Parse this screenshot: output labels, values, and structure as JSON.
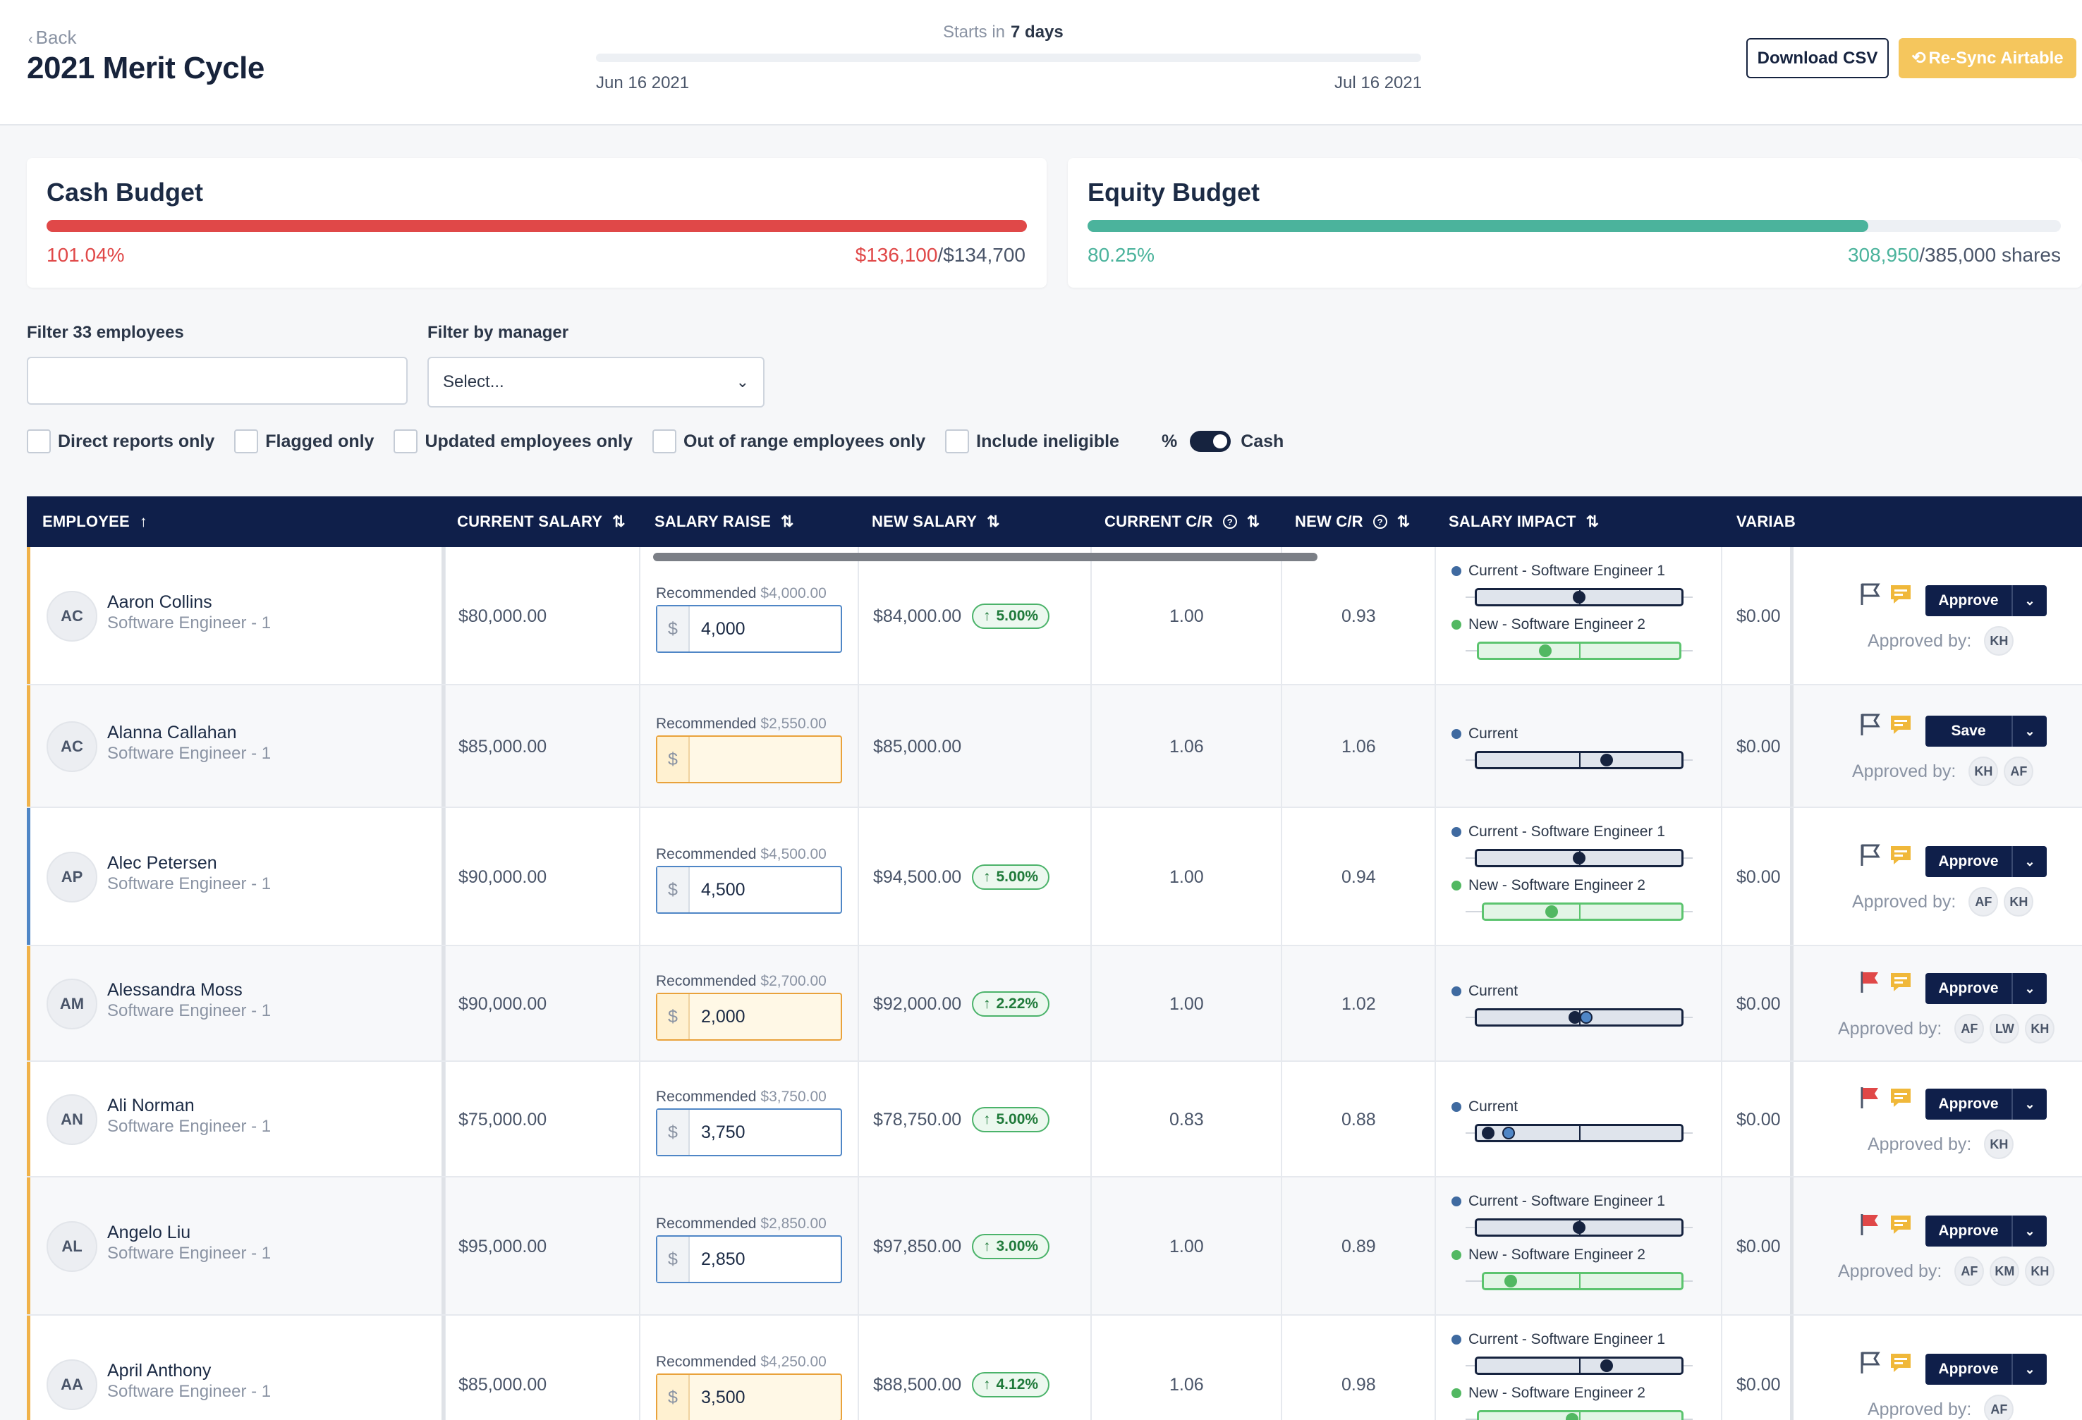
{
  "header": {
    "back_label": "Back",
    "title": "2021 Merit Cycle",
    "starts_prefix": "Starts in",
    "starts_value": "7 days",
    "date_start": "Jun 16 2021",
    "date_end": "Jul 16 2021",
    "download_label": "Download CSV",
    "resync_label": "Re-Sync Airtable"
  },
  "budgets": {
    "cash": {
      "title": "Cash Budget",
      "percent": "101.04%",
      "used": "$136,100",
      "total": "/$134,700",
      "fill_percent": 100,
      "color": "#e04848"
    },
    "equity": {
      "title": "Equity Budget",
      "percent": "80.25%",
      "used": "308,950",
      "total": "/385,000 shares",
      "fill_percent": 80.25,
      "color": "#4bb39c"
    }
  },
  "filters": {
    "employees_label": "Filter 33 employees",
    "employees_value": "",
    "manager_label": "Filter by manager",
    "manager_value": "Select...",
    "checkboxes": [
      "Direct reports only",
      "Flagged only",
      "Updated employees only",
      "Out of range employees only",
      "Include ineligible"
    ],
    "toggle_left": "%",
    "toggle_right": "Cash"
  },
  "table": {
    "columns": [
      "EMPLOYEE",
      "CURRENT SALARY",
      "SALARY RAISE",
      "NEW SALARY",
      "CURRENT C/R",
      "NEW C/R",
      "SALARY IMPACT",
      "VARIAB"
    ],
    "recommended_prefix": "Recommended",
    "approved_by_label": "Approved by:",
    "rows": [
      {
        "initials": "AC",
        "name": "Aaron Collins",
        "title": "Software Engineer - 1",
        "current_salary": "$80,000.00",
        "recommended": "$4,000.00",
        "raise": "4,000",
        "new_salary": "$84,000.00",
        "raise_pct": "5.00%",
        "current_cr": "1.00",
        "new_cr": "0.93",
        "impact_current": "Current - Software Engineer 1",
        "impact_new": "New - Software Engineer 2",
        "variable": "$0.00",
        "action": "Approve",
        "approvers": [
          "KH"
        ]
      },
      {
        "initials": "AC",
        "name": "Alanna Callahan",
        "title": "Software Engineer - 1",
        "current_salary": "$85,000.00",
        "recommended": "$2,550.00",
        "raise": "",
        "new_salary": "$85,000.00",
        "raise_pct": "",
        "current_cr": "1.06",
        "new_cr": "1.06",
        "impact_current": "Current",
        "impact_new": "",
        "variable": "$0.00",
        "action": "Save",
        "approvers": [
          "KH",
          "AF"
        ]
      },
      {
        "initials": "AP",
        "name": "Alec Petersen",
        "title": "Software Engineer - 1",
        "current_salary": "$90,000.00",
        "recommended": "$4,500.00",
        "raise": "4,500",
        "new_salary": "$94,500.00",
        "raise_pct": "5.00%",
        "current_cr": "1.00",
        "new_cr": "0.94",
        "impact_current": "Current - Software Engineer 1",
        "impact_new": "New - Software Engineer 2",
        "variable": "$0.00",
        "action": "Approve",
        "approvers": [
          "AF",
          "KH"
        ]
      },
      {
        "initials": "AM",
        "name": "Alessandra Moss",
        "title": "Software Engineer - 1",
        "current_salary": "$90,000.00",
        "recommended": "$2,700.00",
        "raise": "2,000",
        "new_salary": "$92,000.00",
        "raise_pct": "2.22%",
        "current_cr": "1.00",
        "new_cr": "1.02",
        "impact_current": "Current",
        "impact_new": "",
        "variable": "$0.00",
        "action": "Approve",
        "approvers": [
          "AF",
          "LW",
          "KH"
        ]
      },
      {
        "initials": "AN",
        "name": "Ali Norman",
        "title": "Software Engineer - 1",
        "current_salary": "$75,000.00",
        "recommended": "$3,750.00",
        "raise": "3,750",
        "new_salary": "$78,750.00",
        "raise_pct": "5.00%",
        "current_cr": "0.83",
        "new_cr": "0.88",
        "impact_current": "Current",
        "impact_new": "",
        "variable": "$0.00",
        "action": "Approve",
        "approvers": [
          "KH"
        ]
      },
      {
        "initials": "AL",
        "name": "Angelo Liu",
        "title": "Software Engineer - 1",
        "current_salary": "$95,000.00",
        "recommended": "$2,850.00",
        "raise": "2,850",
        "new_salary": "$97,850.00",
        "raise_pct": "3.00%",
        "current_cr": "1.00",
        "new_cr": "0.89",
        "impact_current": "Current - Software Engineer 1",
        "impact_new": "New - Software Engineer 2",
        "variable": "$0.00",
        "action": "Approve",
        "approvers": [
          "AF",
          "KM",
          "KH"
        ]
      },
      {
        "initials": "AA",
        "name": "April Anthony",
        "title": "Software Engineer - 1",
        "current_salary": "$85,000.00",
        "recommended": "$4,250.00",
        "raise": "3,500",
        "new_salary": "$88,500.00",
        "raise_pct": "4.12%",
        "current_cr": "1.06",
        "new_cr": "0.98",
        "impact_current": "Current - Software Engineer 1",
        "impact_new": "New - Software Engineer 2",
        "variable": "$0.00",
        "action": "Approve",
        "approvers": [
          "AF"
        ]
      }
    ]
  }
}
